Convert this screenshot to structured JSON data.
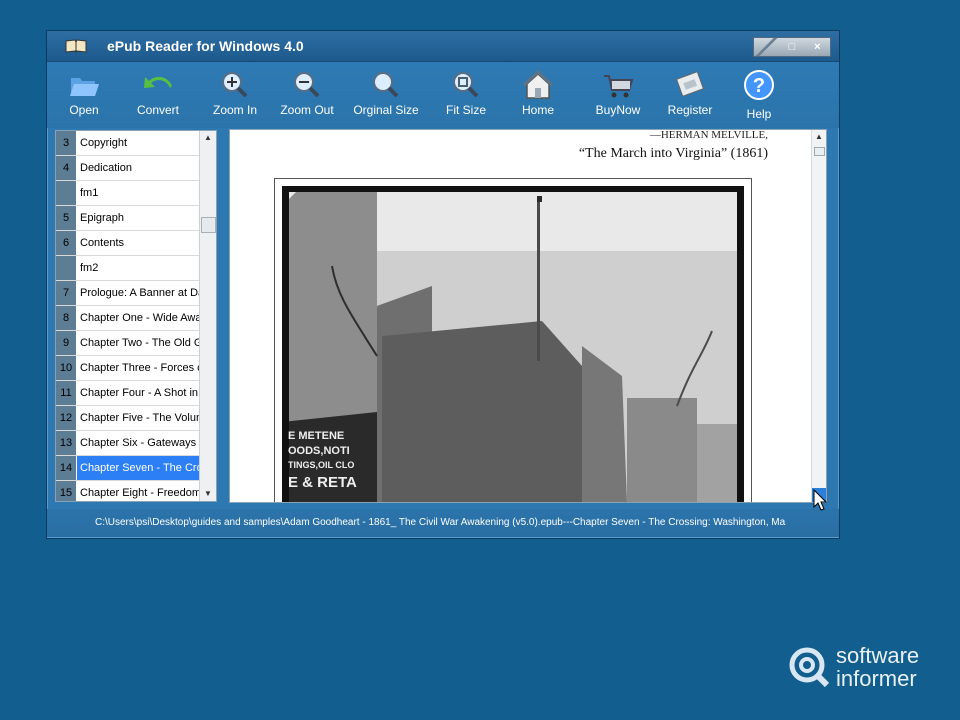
{
  "window": {
    "title": "ePub Reader for Windows 4.0",
    "controls": [
      "",
      "□",
      "×"
    ]
  },
  "toolbar": [
    {
      "label": "Open",
      "icon": "open-folder-icon"
    },
    {
      "label": "Convert",
      "icon": "convert-arrow-icon"
    },
    {
      "label": "Zoom In",
      "icon": "zoom-in-icon"
    },
    {
      "label": "Zoom Out",
      "icon": "zoom-out-icon"
    },
    {
      "label": "Orginal Size",
      "icon": "original-size-icon"
    },
    {
      "label": "Fit Size",
      "icon": "fit-size-icon"
    },
    {
      "label": "Home",
      "icon": "home-icon"
    },
    {
      "label": "BuyNow",
      "icon": "shopping-cart-icon"
    },
    {
      "label": "Register",
      "icon": "register-icon"
    },
    {
      "label": "Help",
      "icon": "help-icon"
    }
  ],
  "toc": [
    {
      "num": "3",
      "title": "Copyright"
    },
    {
      "num": "4",
      "title": "Dedication"
    },
    {
      "num": "",
      "title": "fm1"
    },
    {
      "num": "5",
      "title": "Epigraph"
    },
    {
      "num": "6",
      "title": "Contents"
    },
    {
      "num": "",
      "title": "fm2"
    },
    {
      "num": "7",
      "title": "Prologue: A Banner at Da"
    },
    {
      "num": "8",
      "title": "Chapter One - Wide Awa"
    },
    {
      "num": "9",
      "title": "Chapter Two - The Old G"
    },
    {
      "num": "10",
      "title": "Chapter Three - Forces c"
    },
    {
      "num": "11",
      "title": "Chapter Four - A Shot in"
    },
    {
      "num": "12",
      "title": "Chapter Five - The Volun"
    },
    {
      "num": "13",
      "title": "Chapter Six - Gateways t"
    },
    {
      "num": "14",
      "title": "Chapter Seven - The Cro",
      "selected": true
    },
    {
      "num": "15",
      "title": "Chapter Eight - Freedom"
    }
  ],
  "reader": {
    "quote_author": "—HERMAN MELVILLE,",
    "quote_title": "“The March into Virginia” (1861)",
    "photo_sign_1": "E METENE",
    "photo_sign_2": "OODS,NOTI",
    "photo_sign_3": "TINGS,OIL CLO",
    "photo_sign_4": "E & RETA"
  },
  "status": {
    "path": "C:\\Users\\psi\\Desktop\\guides and samples\\Adam Goodheart - 1861_ The Civil War Awakening (v5.0).epub---Chapter Seven - The Crossing: Washington, Ma"
  },
  "watermark": {
    "line1": "software",
    "line2": "informer"
  },
  "colors": {
    "desktop": "#115e8f",
    "window": "#2d78b0",
    "selection": "#2d7ff5"
  }
}
